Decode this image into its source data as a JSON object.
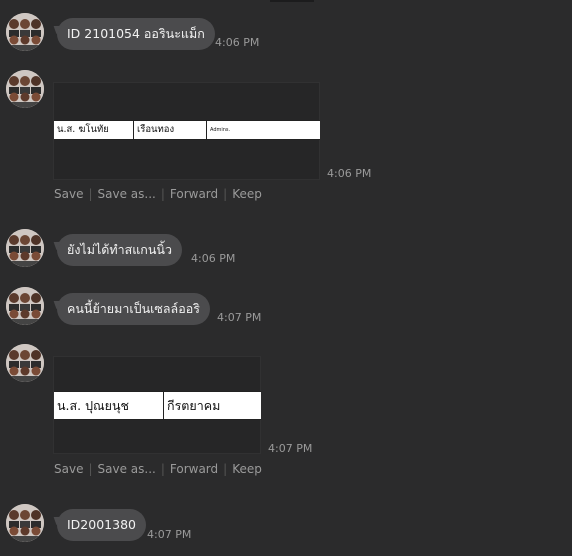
{
  "messages": [
    {
      "kind": "text",
      "text": "ID 2101054 ออรินะแม็ก",
      "time": "4:06 PM"
    },
    {
      "kind": "image",
      "table": [
        "น.ส. ฆโนทัย",
        "เรือนทอง",
        "Admins."
      ],
      "time": "4:06 PM",
      "actions": [
        "Save",
        "Save as...",
        "Forward",
        "Keep"
      ]
    },
    {
      "kind": "text",
      "text": "ยังไม่ได้ทำสแกนนิ้ว",
      "time": "4:06 PM"
    },
    {
      "kind": "text",
      "text": "คนนี้ย้ายมาเป็นเซลล์ออริ",
      "time": "4:07 PM"
    },
    {
      "kind": "image",
      "table": [
        "น.ส. ปุณยนุช",
        "กีรตยาคม"
      ],
      "time": "4:07 PM",
      "actions": [
        "Save",
        "Save as...",
        "Forward",
        "Keep"
      ]
    },
    {
      "kind": "text",
      "text": "ID2001380",
      "time": "4:07 PM"
    }
  ],
  "colors": {
    "background": "#2b2b2c",
    "bubble": "#4b4b4d",
    "timestamp": "#9a9a9a"
  }
}
